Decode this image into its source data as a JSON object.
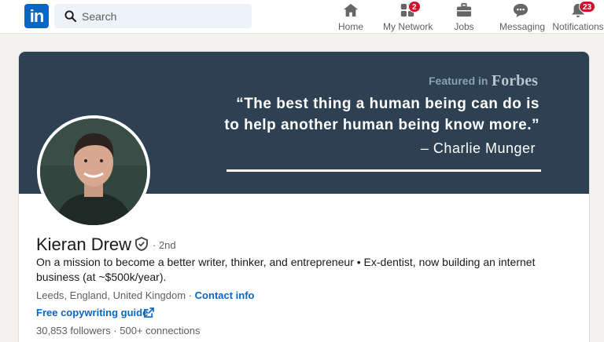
{
  "nav": {
    "logo": "in",
    "search_placeholder": "Search",
    "items": [
      {
        "label": "Home",
        "badge": ""
      },
      {
        "label": "My Network",
        "badge": "2"
      },
      {
        "label": "Jobs",
        "badge": ""
      },
      {
        "label": "Messaging",
        "badge": ""
      },
      {
        "label": "Notifications",
        "badge": "23"
      }
    ]
  },
  "banner": {
    "featured_in": "Featured in",
    "brand": "Forbes",
    "quote_line1": "“The best thing a human being can do is",
    "quote_line2": "to help another human being know more.”",
    "author": "– Charlie Munger"
  },
  "profile": {
    "name": "Kieran Drew",
    "degree": "· 2nd",
    "headline": "On a mission to become a better writer, thinker, and entrepreneur • Ex-dentist, now building an internet business (at ~$500k/year).",
    "location": "Leeds, England, United Kingdom",
    "separator": "·",
    "contact_info": "Contact info",
    "link_text": "Free copywriting guide",
    "followers": "30,853 followers",
    "connections": "· 500+ connections"
  },
  "colors": {
    "brand_blue": "#0a66c2",
    "banner_bg": "#2d4153",
    "badge_red": "#cb112d"
  }
}
